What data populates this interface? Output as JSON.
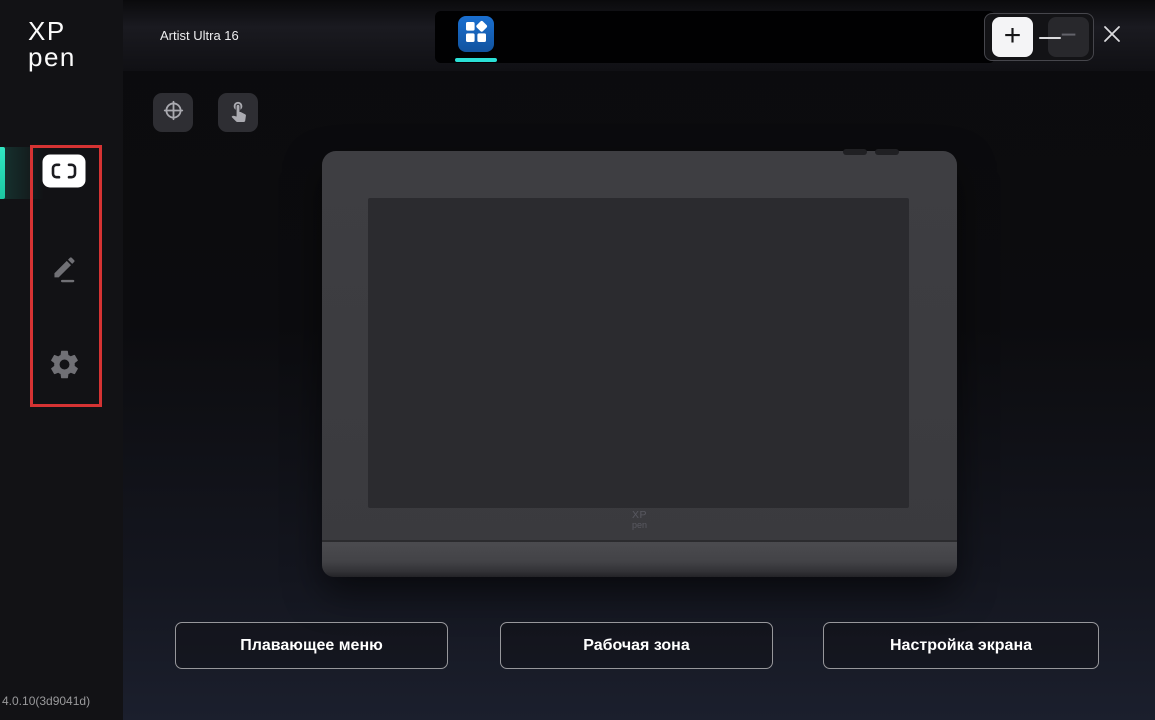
{
  "window": {
    "title": "Artist Ultra 16",
    "version": "4.0.10(3d9041d)"
  },
  "brand": {
    "line1": "XP",
    "line2": "pen"
  },
  "sidebar": {
    "items": [
      {
        "id": "work-area",
        "icon": "screen-area-icon",
        "active": true
      },
      {
        "id": "pen-settings",
        "icon": "pen-icon",
        "active": false
      },
      {
        "id": "settings",
        "icon": "gear-icon",
        "active": false
      }
    ],
    "annotation_color": "#d53333"
  },
  "tab_bar": {
    "active_tab_icon": "device-grid-icon",
    "add_label": "+",
    "remove_label": "−"
  },
  "toolbar": {
    "buttons": [
      {
        "icon": "calibration-crosshair-icon"
      },
      {
        "icon": "touch-gesture-icon"
      }
    ]
  },
  "device_preview": {
    "logo_line1": "XP",
    "logo_line2": "pen"
  },
  "actions": [
    {
      "label": "Плавающее меню"
    },
    {
      "label": "Рабочая зона"
    },
    {
      "label": "Настройка экрана"
    }
  ],
  "colors": {
    "accent_teal": "#2ce2bd",
    "tab_blue": "#1565c2",
    "underline_cyan": "#2be0d6",
    "annotation_red": "#d53333"
  }
}
